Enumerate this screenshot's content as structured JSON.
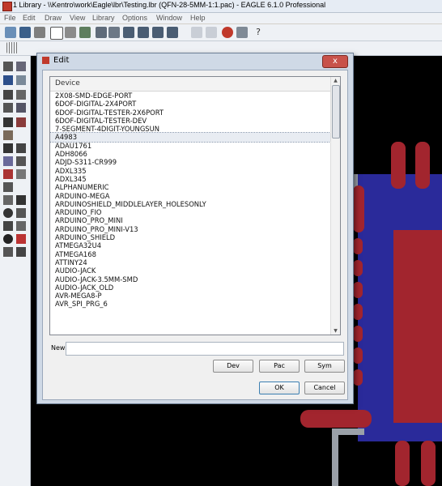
{
  "app": {
    "title": "1 Library - \\\\Kentro\\work\\Eagle\\lbr\\Testing.lbr (QFN-28-5MM-1:1.pac) - EAGLE 6.1.0 Professional",
    "menu": [
      "File",
      "Edit",
      "Draw",
      "View",
      "Library",
      "Options",
      "Window",
      "Help"
    ]
  },
  "toolbar": {
    "icons": [
      "open-icon",
      "save-icon",
      "print-icon",
      "cam-icon",
      "ulp-icon",
      "script-icon",
      "zoom-fit-icon",
      "zoom-in-icon",
      "zoom-out-icon",
      "redraw-icon",
      "zoom-select-icon",
      "undo-icon",
      "redo-icon",
      "stop-icon",
      "go-icon",
      "help-icon"
    ]
  },
  "dialog": {
    "title": "Edit",
    "close_label": "x",
    "column_header": "Device",
    "devices": [
      "2X08-SMD-EDGE-PORT",
      "6DOF-DIGITAL-2X4PORT",
      "6DOF-DIGITAL-TESTER-2X6PORT",
      "6DOF-DIGITAL-TESTER-DEV",
      "7-SEGMENT-4DIGIT-YOUNGSUN",
      "A4983",
      "ADAU1761",
      "ADH8066",
      "ADJD-S311-CR999",
      "ADXL335",
      "ADXL345",
      "ALPHANUMERIC",
      "ARDUINO-MEGA",
      "ARDUINOSHIELD_MIDDLELAYER_HOLESONLY",
      "ARDUINO_FIO",
      "ARDUINO_PRO_MINI",
      "ARDUINO_PRO_MINI-V13",
      "ARDUINO_SHIELD",
      "ATMEGA32U4",
      "ATMEGA168",
      "ATTINY24",
      "AUDIO-JACK",
      "AUDIO-JACK-3.5MM-SMD",
      "AUDIO-JACK_OLD",
      "AVR-MEGA8-P",
      "AVR_SPI_PRG_6"
    ],
    "selected_index": 5,
    "new_label": "New:",
    "new_value": "",
    "buttons": {
      "dev": "Dev",
      "pac": "Pac",
      "sym": "Sym",
      "ok": "OK",
      "cancel": "Cancel"
    }
  }
}
